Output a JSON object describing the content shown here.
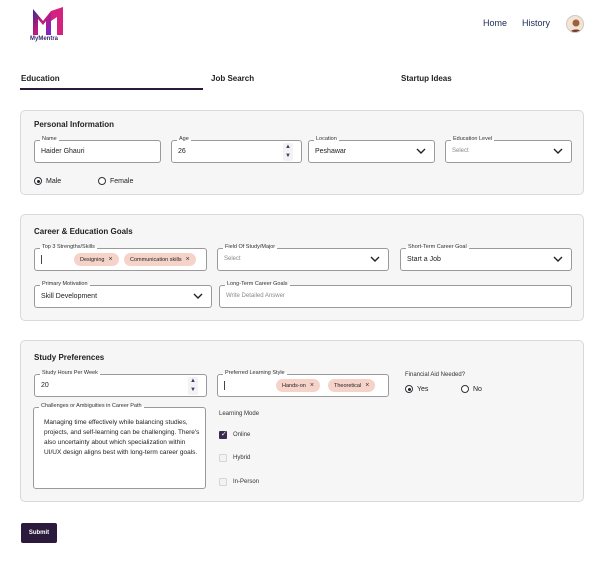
{
  "header": {
    "brand": "MyMentra",
    "nav": {
      "home": "Home",
      "history": "History"
    },
    "colors": {
      "brand_dark": "#2b1a3c",
      "chip_bg": "#f6d3c9"
    }
  },
  "tabs": [
    {
      "label": "Education",
      "active": true
    },
    {
      "label": "Job Search",
      "active": false
    },
    {
      "label": "Startup Ideas",
      "active": false
    }
  ],
  "personal": {
    "title": "Personal Information",
    "name": {
      "label": "Name",
      "value": "Haider Ghauri"
    },
    "age": {
      "label": "Age",
      "value": "26"
    },
    "location": {
      "label": "Location",
      "value": "Peshawar"
    },
    "education_level": {
      "label": "Education Level",
      "placeholder": "Select"
    },
    "gender": {
      "male": "Male",
      "female": "Female",
      "selected": "Male"
    }
  },
  "goals": {
    "title": "Career & Education Goals",
    "strengths": {
      "label": "Top 3 Strengths/Skills",
      "chips": [
        "Designing",
        "Communication skills"
      ]
    },
    "field_of_study": {
      "label": "Field Of Study/Major",
      "placeholder": "Select"
    },
    "short_term": {
      "label": "Short-Term Career Goal",
      "value": "Start a Job"
    },
    "motivation": {
      "label": "Primary Motivation",
      "value": "Skill Development"
    },
    "long_term": {
      "label": "Long-Term Career Goals",
      "placeholder": "Write Detailed Answer"
    }
  },
  "study": {
    "title": "Study Preferences",
    "hours": {
      "label": "Study Hours Per Week",
      "value": "20"
    },
    "learning_style": {
      "label": "Preferred Learning Style",
      "chips": [
        "Hands-on",
        "Theoretical"
      ]
    },
    "financial_aid": {
      "label": "Financial Aid Needed?",
      "yes": "Yes",
      "no": "No",
      "selected": "Yes"
    },
    "challenges": {
      "label": "Challenges or Ambiguities in Career Path",
      "value": "Managing time effectively while balancing studies, projects, and self-learning can be challenging. There's also uncertainty about which specialization within UI/UX design aligns best with long-term career goals."
    },
    "learning_mode": {
      "label": "Learning Mode",
      "options": [
        {
          "label": "Online",
          "checked": true
        },
        {
          "label": "Hybrid",
          "checked": false
        },
        {
          "label": "In-Person",
          "checked": false
        }
      ]
    }
  },
  "submit_label": "Submit"
}
